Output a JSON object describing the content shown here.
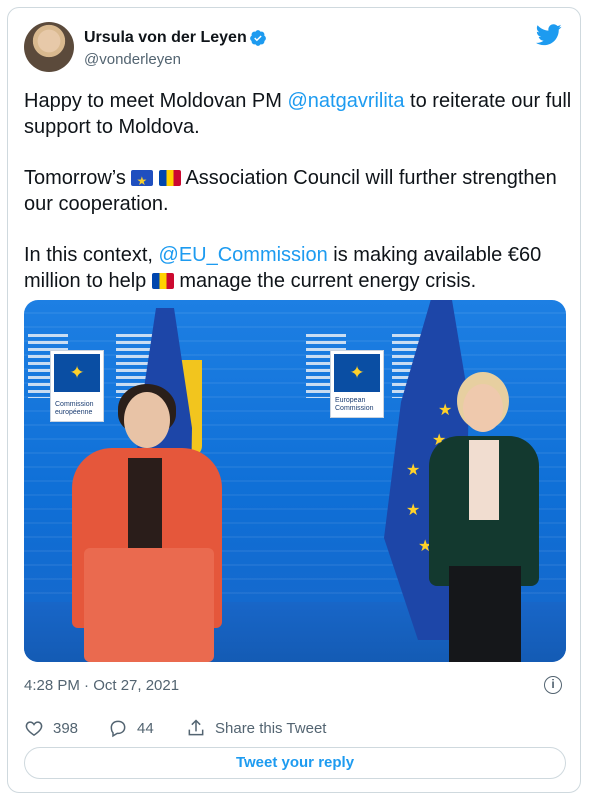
{
  "author": {
    "name": "Ursula von der Leyen",
    "handle": "@vonderleyen",
    "verified_icon": "verified-badge-icon",
    "avatar_icon": "avatar"
  },
  "brand_icon": "twitter-bird-icon",
  "tweet": {
    "p1_a": "Happy to meet Moldovan PM ",
    "p1_mention": "@natgavrilita",
    "p1_b": " to reiterate our full support to Moldova.",
    "p2_a": "Tomorrow’s ",
    "p2_b": " Association Council will further strengthen our cooperation.",
    "p3_a": "In this context, ",
    "p3_mention": "@EU_Commission",
    "p3_b": " is making available €60 million to help ",
    "p3_c": " manage the current energy crisis."
  },
  "photo": {
    "logo_left_text": "Commission européenne",
    "logo_right_text": "European Commission"
  },
  "timestamp": "4:28 PM · Oct 27, 2021",
  "info_icon": "info-icon",
  "actions": {
    "likes": "398",
    "replies": "44",
    "share_label": "Share this Tweet"
  },
  "reply_button": "Tweet your reply",
  "colors": {
    "accent": "#1d9bf0",
    "secondary_text": "#536471",
    "border": "#cfd9de"
  }
}
